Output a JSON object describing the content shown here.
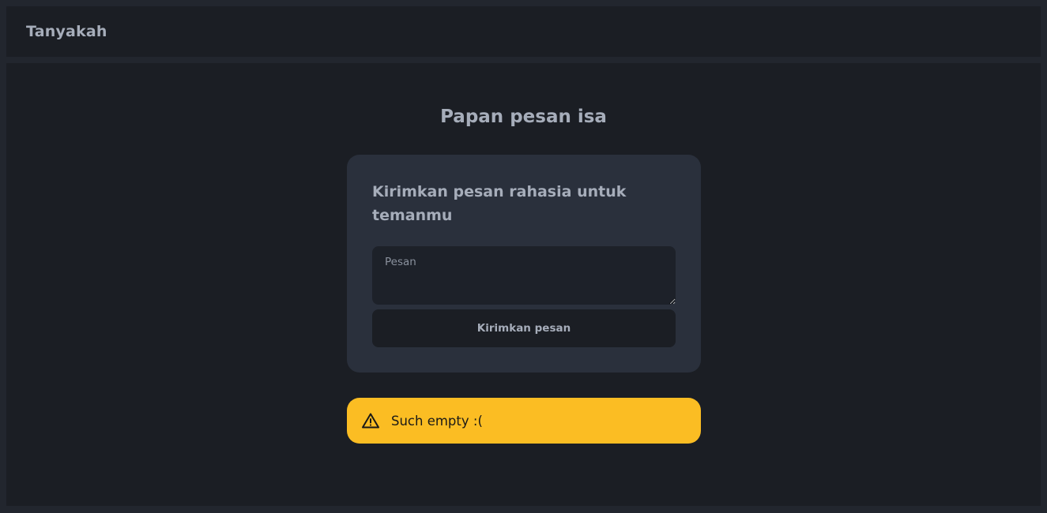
{
  "navbar": {
    "brand": "Tanyakah"
  },
  "main": {
    "page_title": "Papan pesan isa",
    "card": {
      "title": "Kirimkan pesan rahasia untuk temanmu",
      "message_input": {
        "placeholder": "Pesan",
        "value": ""
      },
      "send_button_label": "Kirimkan pesan"
    },
    "alert": {
      "icon": "warning-icon",
      "text": "Such empty :(",
      "color": "#fbbd23"
    }
  },
  "colors": {
    "page_bg": "#22262e",
    "panel_bg": "#1b1e24",
    "card_bg": "#2a303c",
    "text": "#a6adba",
    "warning": "#fbbd23"
  }
}
